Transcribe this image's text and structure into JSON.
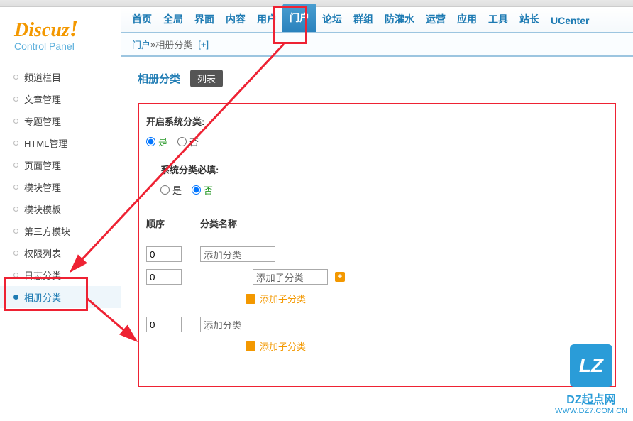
{
  "logo": {
    "main": "Discuz",
    "excl": "!",
    "sub": "Control Panel"
  },
  "topnav": [
    {
      "label": "首页"
    },
    {
      "label": "全局"
    },
    {
      "label": "界面"
    },
    {
      "label": "内容"
    },
    {
      "label": "用户"
    },
    {
      "label": "门户",
      "active": true
    },
    {
      "label": "论坛"
    },
    {
      "label": "群组"
    },
    {
      "label": "防灌水"
    },
    {
      "label": "运营"
    },
    {
      "label": "应用"
    },
    {
      "label": "工具"
    },
    {
      "label": "站长"
    },
    {
      "label": "UCenter"
    }
  ],
  "breadcrumb": {
    "root": "门户",
    "sep": " » ",
    "current": "相册分类",
    "plus": "[+]"
  },
  "sidenav": [
    {
      "label": "频道栏目"
    },
    {
      "label": "文章管理"
    },
    {
      "label": "专题管理"
    },
    {
      "label": "HTML管理"
    },
    {
      "label": "页面管理"
    },
    {
      "label": "模块管理"
    },
    {
      "label": "模块模板"
    },
    {
      "label": "第三方模块"
    },
    {
      "label": "权限列表"
    },
    {
      "label": "日志分类"
    },
    {
      "label": "相册分类",
      "active": true
    }
  ],
  "section": {
    "t1": "相册分类",
    "t2": "列表"
  },
  "form": {
    "enable_label": "开启系统分类:",
    "required_label": "系统分类必填:",
    "yes": "是",
    "no": "否",
    "col_order": "顺序",
    "col_name": "分类名称",
    "order_val": "0",
    "add_cat": "添加分类",
    "add_subcat": "添加子分类"
  },
  "watermark": {
    "lz": "LZ",
    "line1": "DZ起点网",
    "line2": "WWW.DZ7.COM.CN"
  }
}
